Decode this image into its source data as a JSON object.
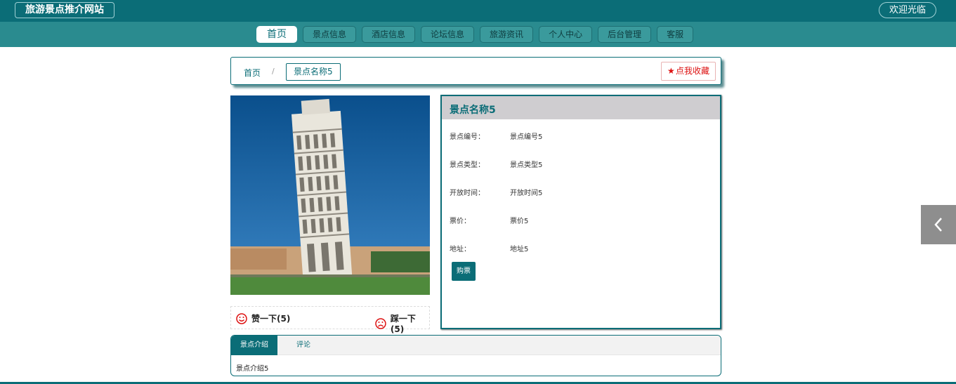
{
  "header": {
    "site_title": "旅游景点推介网站",
    "welcome": "欢迎光临"
  },
  "nav": {
    "items": [
      {
        "label": "首页",
        "active": true
      },
      {
        "label": "景点信息",
        "active": false
      },
      {
        "label": "酒店信息",
        "active": false
      },
      {
        "label": "论坛信息",
        "active": false
      },
      {
        "label": "旅游资讯",
        "active": false
      },
      {
        "label": "个人中心",
        "active": false
      },
      {
        "label": "后台管理",
        "active": false
      },
      {
        "label": "客服",
        "active": false
      }
    ]
  },
  "breadcrumb": {
    "home": "首页",
    "separator": "/",
    "current": "景点名称5"
  },
  "favorite": {
    "icon": "star-icon",
    "label": "点我收藏"
  },
  "photo": {
    "icon": "leaning-tower-photo"
  },
  "reactions": {
    "like_label": "赞一下(5)",
    "dislike_label": "踩一下(5)"
  },
  "detail": {
    "title": "景点名称5",
    "rows": [
      {
        "label": "景点编号：",
        "value": "景点编号5"
      },
      {
        "label": "景点类型：",
        "value": "景点类型5"
      },
      {
        "label": "开放时间：",
        "value": "开放时间5"
      },
      {
        "label": "票价：",
        "value": "票价5"
      },
      {
        "label": "地址：",
        "value": "地址5"
      }
    ],
    "buy_label": "购票"
  },
  "tabs": {
    "items": [
      {
        "label": "景点介绍",
        "active": true
      },
      {
        "label": "评论",
        "active": false
      }
    ],
    "content": "景点介绍5"
  },
  "colors": {
    "primary": "#0b6d77",
    "nav_bg": "#2a8b8f",
    "favorite": "#dd1111"
  }
}
